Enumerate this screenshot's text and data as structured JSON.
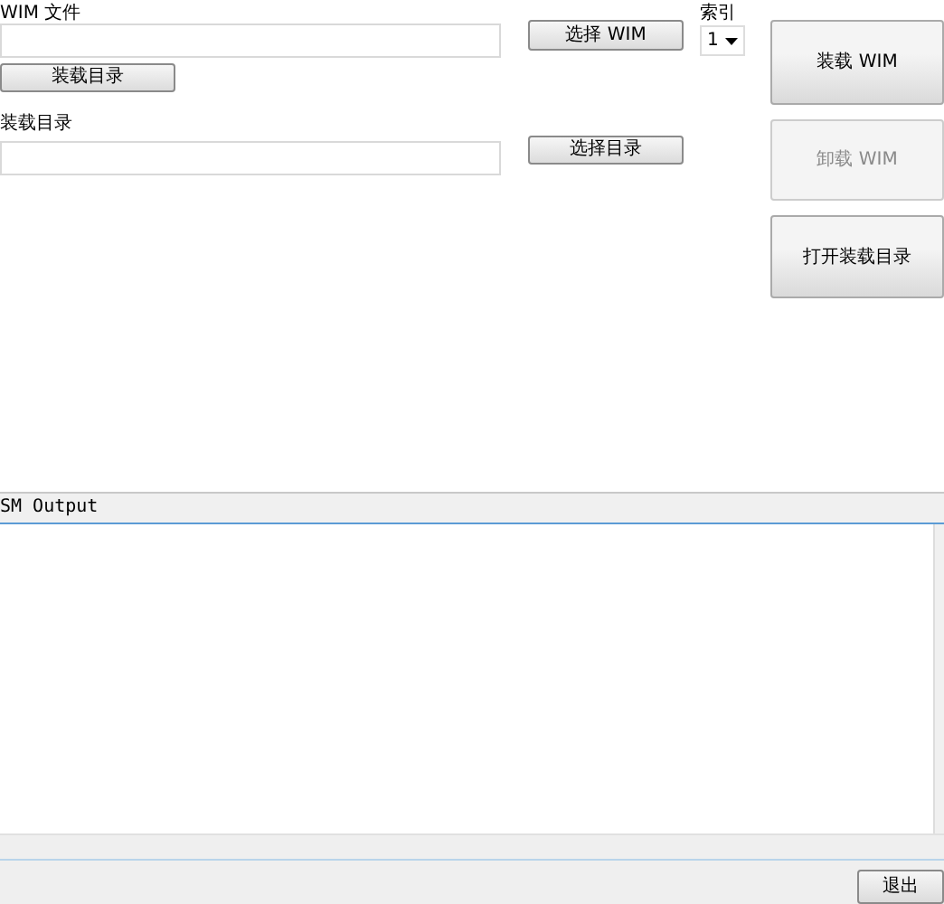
{
  "wim_file": {
    "label": "WIM 文件",
    "browse_button": "选择 WIM",
    "mount_dir_button": "装载目录"
  },
  "index": {
    "label": "索引",
    "value": "1"
  },
  "mount_dir": {
    "label": "装载目录",
    "browse_button": "选择目录"
  },
  "actions": [
    {
      "label": "装载 WIM",
      "disabled": false
    },
    {
      "label": "卸载 WIM",
      "disabled": true
    },
    {
      "label": "打开装载目录",
      "disabled": false
    }
  ],
  "output": {
    "title": "SM Output"
  },
  "footer_button": "退出"
}
